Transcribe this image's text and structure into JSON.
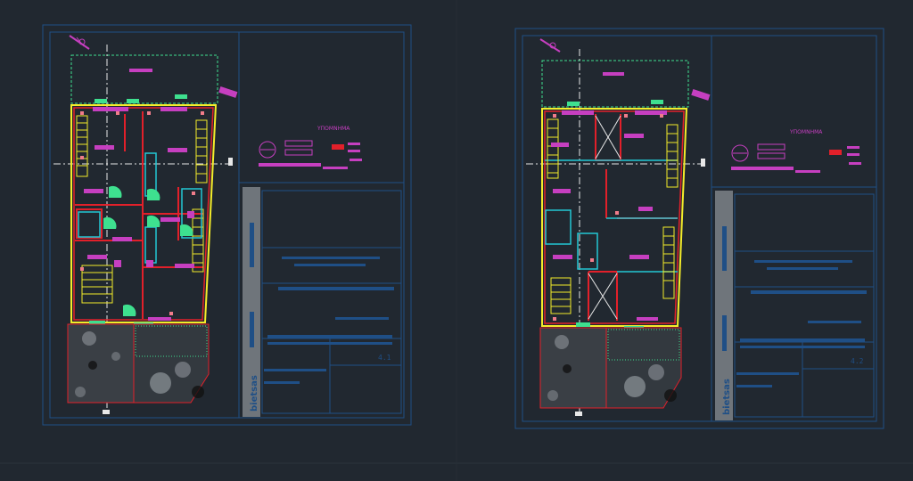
{
  "viewport": {
    "background": "#212830",
    "colors": {
      "frame": "#1f4f86",
      "wall_red": "#e2202a",
      "wall_yellow": "#f4ec2a",
      "magenta": "#c63fc0",
      "cyan": "#23c7d4",
      "green": "#3ee08f",
      "pink": "#f07c8a",
      "grey_fill": "#8f959b",
      "white": "#e8e8e8",
      "title_grey": "#6f757b"
    }
  },
  "sheets": [
    {
      "name": "sheet-left",
      "legend_title": "ΥΠΟΜΝΗΜΑ",
      "vertical_brand": "bietsas",
      "sheet_number": "4.1"
    },
    {
      "name": "sheet-right",
      "legend_title": "ΥΠΟΜΝΗΜΑ",
      "vertical_brand": "bietsas",
      "sheet_number": "4.2"
    }
  ]
}
